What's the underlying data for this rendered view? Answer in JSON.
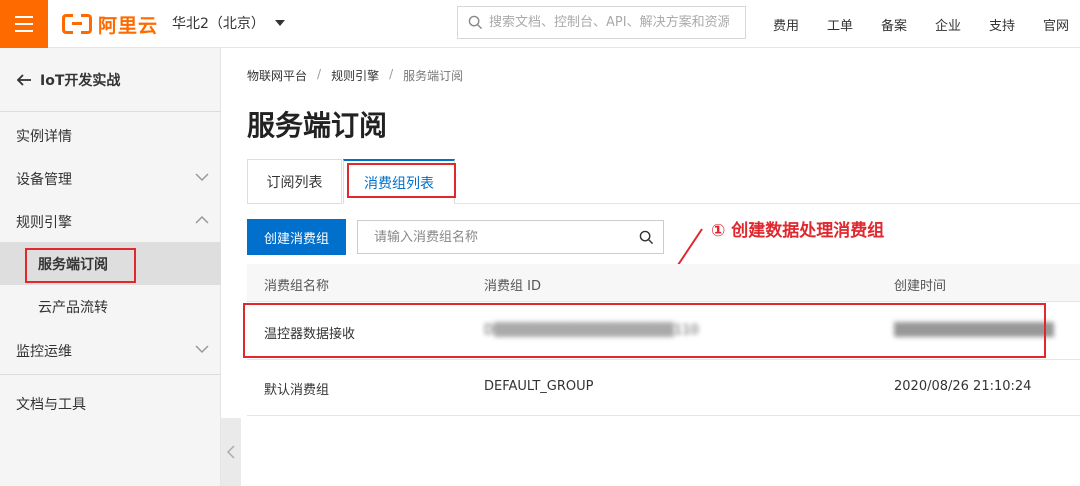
{
  "header": {
    "logo_text": "阿里云",
    "region": "华北2（北京）",
    "search_placeholder": "搜索文档、控制台、API、解决方案和资源",
    "nav": [
      "费用",
      "工单",
      "备案",
      "企业",
      "支持",
      "官网"
    ]
  },
  "sidebar": {
    "back_label": "IoT开发实战",
    "items": [
      {
        "label": "实例详情"
      },
      {
        "label": "设备管理"
      },
      {
        "label": "规则引擎"
      },
      {
        "label": "服务端订阅"
      },
      {
        "label": "云产品流转"
      },
      {
        "label": "监控运维"
      },
      {
        "label": "文档与工具"
      }
    ]
  },
  "breadcrumb": [
    "物联网平台",
    "规则引擎",
    "服务端订阅"
  ],
  "page_title": "服务端订阅",
  "tabs": [
    {
      "label": "订阅列表"
    },
    {
      "label": "消费组列表"
    }
  ],
  "toolbar": {
    "create_label": "创建消费组",
    "search_placeholder": "请输入消费组名称"
  },
  "annotation": "① 创建数据处理消费组",
  "table": {
    "columns": [
      "消费组名称",
      "消费组 ID",
      "创建时间"
    ],
    "rows": [
      {
        "name": "温控器数据接收",
        "id": "D▒▒▒▒▒▒▒▒▒▒▒▒▒▒▒▒▒▒110",
        "created": "▒▒▒▒▒▒▒▒▒▒▒▒▒▒▒▒"
      },
      {
        "name": "默认消费组",
        "id": "DEFAULT_GROUP",
        "created": "2020/08/26 21:10:24"
      }
    ]
  },
  "colors": {
    "brand": "#ff6a00",
    "primary": "#0070cc",
    "annotation_red": "#e0282e"
  }
}
